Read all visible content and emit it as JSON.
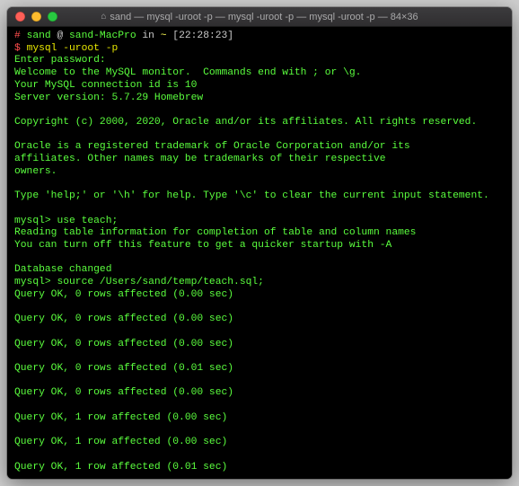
{
  "window": {
    "title": "sand — mysql -uroot -p — mysql -uroot -p — mysql -uroot -p — 84×36"
  },
  "prompt": {
    "hash": "#",
    "user": "sand",
    "at": "@",
    "host": "sand-MacPro",
    "in_word": "in",
    "path": "~",
    "time": "[22:28:23]"
  },
  "cmd1": {
    "dollar": "$",
    "text": "mysql -uroot -p"
  },
  "banner": {
    "l1": "Enter password:",
    "l2": "Welcome to the MySQL monitor.  Commands end with ; or \\g.",
    "l3": "Your MySQL connection id is 10",
    "l4": "Server version: 5.7.29 Homebrew",
    "l5": "Copyright (c) 2000, 2020, Oracle and/or its affiliates. All rights reserved.",
    "l6": "Oracle is a registered trademark of Oracle Corporation and/or its",
    "l7": "affiliates. Other names may be trademarks of their respective",
    "l8": "owners.",
    "l9": "Type 'help;' or '\\h' for help. Type '\\c' to clear the current input statement."
  },
  "session": {
    "p1": "mysql> use teach;",
    "r1": "Reading table information for completion of table and column names",
    "r2": "You can turn off this feature to get a quicker startup with -A",
    "dbchanged": "Database changed",
    "p2": "mysql> source /Users/sand/temp/teach.sql;",
    "q1": "Query OK, 0 rows affected (0.00 sec)",
    "q2": "Query OK, 0 rows affected (0.00 sec)",
    "q3": "Query OK, 0 rows affected (0.00 sec)",
    "q4": "Query OK, 0 rows affected (0.01 sec)",
    "q5": "Query OK, 0 rows affected (0.00 sec)",
    "q6": "Query OK, 1 row affected (0.00 sec)",
    "q7": "Query OK, 1 row affected (0.00 sec)",
    "q8": "Query OK, 1 row affected (0.01 sec)"
  }
}
